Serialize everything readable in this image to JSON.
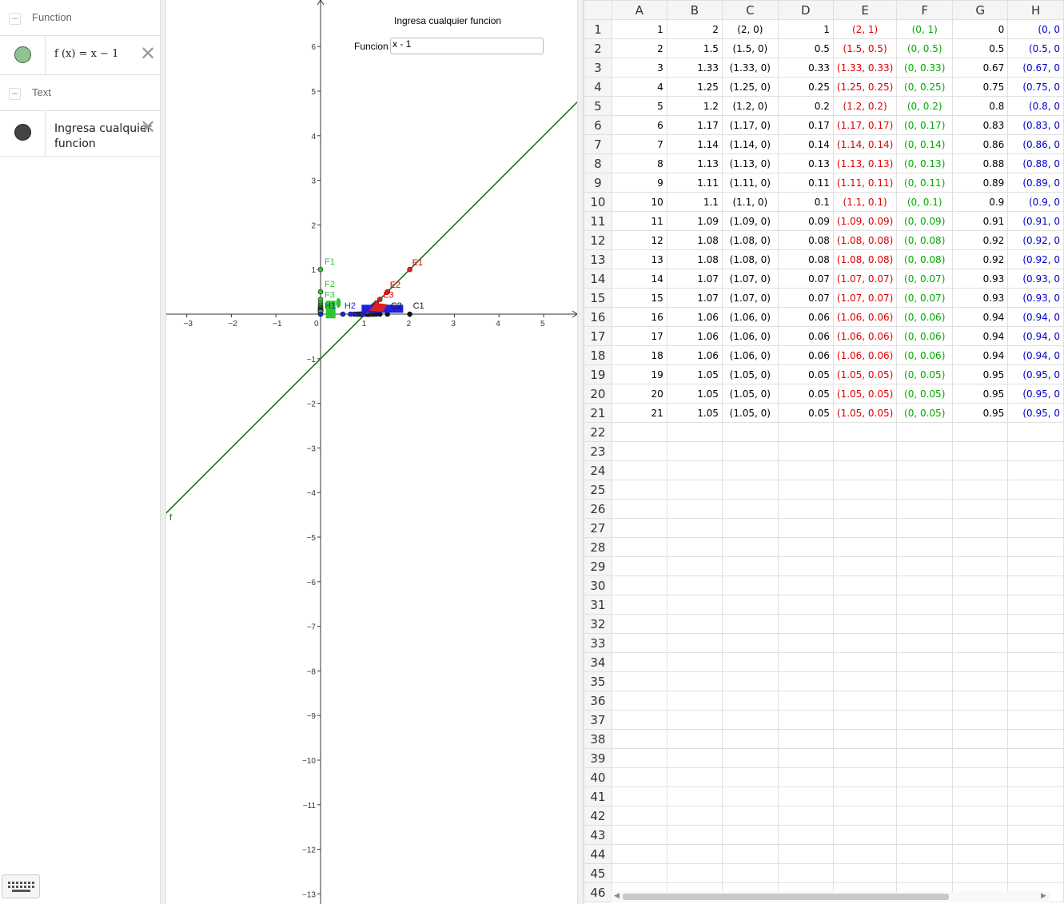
{
  "algebra": {
    "groups": [
      {
        "label": "Function"
      },
      {
        "label": "Text"
      }
    ],
    "function_item": {
      "formula": "f (x)  =  x − 1",
      "marble_color": "#93c193"
    },
    "text_item": {
      "line1": "Ingresa cualquier",
      "line2": "funcion"
    }
  },
  "graphics": {
    "title": "Ingresa cualquier funcion",
    "input_label": "Funcion",
    "input_value": "x - 1",
    "curve_label": "f",
    "line_color": "#1b6e1b",
    "x_ticks": [
      "−3",
      "−2",
      "−1",
      "0",
      "1",
      "2",
      "3",
      "4",
      "5"
    ],
    "y_ticks": [
      "6",
      "5",
      "4",
      "3",
      "2",
      "1",
      "−1",
      "−2",
      "−3",
      "−4",
      "−5",
      "−6",
      "−7",
      "−8",
      "−9",
      "−10",
      "−11",
      "−12",
      "−13"
    ],
    "labels": {
      "F1": "F1",
      "F2": "F2",
      "F3": "F3",
      "E1": "E1",
      "E2": "E2",
      "E3": "E3",
      "C1": "C1",
      "C2": "C2",
      "H1": "H1",
      "H2": "H2"
    }
  },
  "spreadsheet": {
    "columns": [
      "A",
      "B",
      "C",
      "D",
      "E",
      "F",
      "G",
      "H"
    ],
    "column_colors": [
      "black",
      "black",
      "black",
      "black",
      "red",
      "green",
      "black",
      "blue"
    ],
    "rows": [
      [
        "1",
        "2",
        "(2, 0)",
        "1",
        "(2, 1)",
        "(0, 1)",
        "0",
        "(0, 0"
      ],
      [
        "2",
        "1.5",
        "(1.5, 0)",
        "0.5",
        "(1.5, 0.5)",
        "(0, 0.5)",
        "0.5",
        "(0.5, 0"
      ],
      [
        "3",
        "1.33",
        "(1.33, 0)",
        "0.33",
        "(1.33, 0.33)",
        "(0, 0.33)",
        "0.67",
        "(0.67, 0"
      ],
      [
        "4",
        "1.25",
        "(1.25, 0)",
        "0.25",
        "(1.25, 0.25)",
        "(0, 0.25)",
        "0.75",
        "(0.75, 0"
      ],
      [
        "5",
        "1.2",
        "(1.2, 0)",
        "0.2",
        "(1.2, 0.2)",
        "(0, 0.2)",
        "0.8",
        "(0.8, 0"
      ],
      [
        "6",
        "1.17",
        "(1.17, 0)",
        "0.17",
        "(1.17, 0.17)",
        "(0, 0.17)",
        "0.83",
        "(0.83, 0"
      ],
      [
        "7",
        "1.14",
        "(1.14, 0)",
        "0.14",
        "(1.14, 0.14)",
        "(0, 0.14)",
        "0.86",
        "(0.86, 0"
      ],
      [
        "8",
        "1.13",
        "(1.13, 0)",
        "0.13",
        "(1.13, 0.13)",
        "(0, 0.13)",
        "0.88",
        "(0.88, 0"
      ],
      [
        "9",
        "1.11",
        "(1.11, 0)",
        "0.11",
        "(1.11, 0.11)",
        "(0, 0.11)",
        "0.89",
        "(0.89, 0"
      ],
      [
        "10",
        "1.1",
        "(1.1, 0)",
        "0.1",
        "(1.1, 0.1)",
        "(0, 0.1)",
        "0.9",
        "(0.9, 0"
      ],
      [
        "11",
        "1.09",
        "(1.09, 0)",
        "0.09",
        "(1.09, 0.09)",
        "(0, 0.09)",
        "0.91",
        "(0.91, 0"
      ],
      [
        "12",
        "1.08",
        "(1.08, 0)",
        "0.08",
        "(1.08, 0.08)",
        "(0, 0.08)",
        "0.92",
        "(0.92, 0"
      ],
      [
        "13",
        "1.08",
        "(1.08, 0)",
        "0.08",
        "(1.08, 0.08)",
        "(0, 0.08)",
        "0.92",
        "(0.92, 0"
      ],
      [
        "14",
        "1.07",
        "(1.07, 0)",
        "0.07",
        "(1.07, 0.07)",
        "(0, 0.07)",
        "0.93",
        "(0.93, 0"
      ],
      [
        "15",
        "1.07",
        "(1.07, 0)",
        "0.07",
        "(1.07, 0.07)",
        "(0, 0.07)",
        "0.93",
        "(0.93, 0"
      ],
      [
        "16",
        "1.06",
        "(1.06, 0)",
        "0.06",
        "(1.06, 0.06)",
        "(0, 0.06)",
        "0.94",
        "(0.94, 0"
      ],
      [
        "17",
        "1.06",
        "(1.06, 0)",
        "0.06",
        "(1.06, 0.06)",
        "(0, 0.06)",
        "0.94",
        "(0.94, 0"
      ],
      [
        "18",
        "1.06",
        "(1.06, 0)",
        "0.06",
        "(1.06, 0.06)",
        "(0, 0.06)",
        "0.94",
        "(0.94, 0"
      ],
      [
        "19",
        "1.05",
        "(1.05, 0)",
        "0.05",
        "(1.05, 0.05)",
        "(0, 0.05)",
        "0.95",
        "(0.95, 0"
      ],
      [
        "20",
        "1.05",
        "(1.05, 0)",
        "0.05",
        "(1.05, 0.05)",
        "(0, 0.05)",
        "0.95",
        "(0.95, 0"
      ],
      [
        "21",
        "1.05",
        "(1.05, 0)",
        "0.05",
        "(1.05, 0.05)",
        "(0, 0.05)",
        "0.95",
        "(0.95, 0"
      ]
    ],
    "total_rows": 46
  }
}
